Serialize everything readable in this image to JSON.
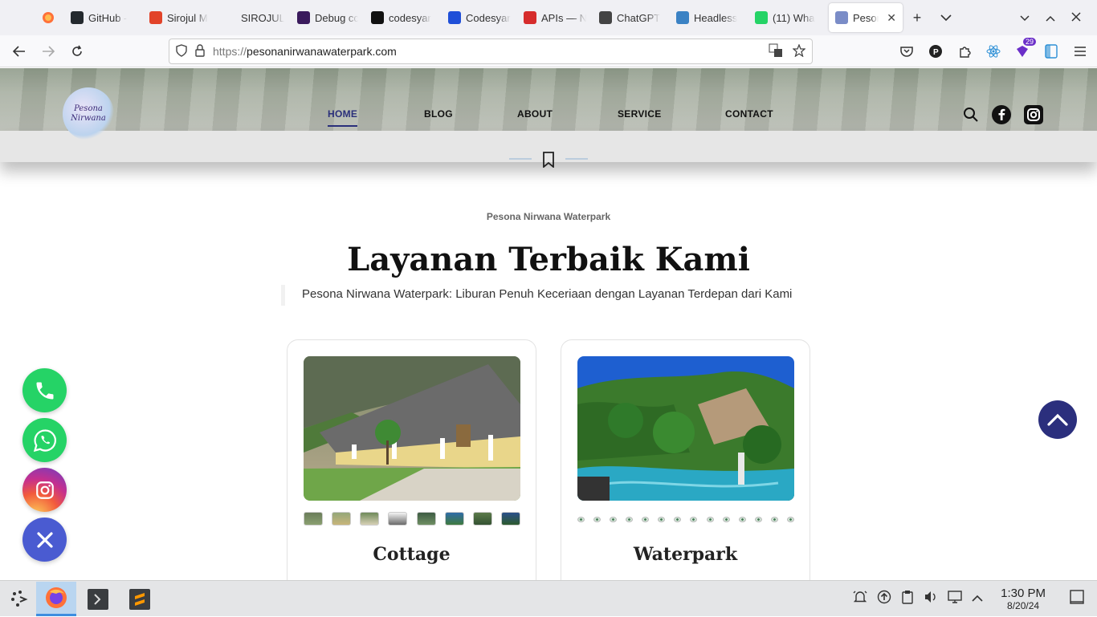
{
  "browser": {
    "tabs": [
      {
        "title": "GitHub -",
        "favicon": "github-icon",
        "color": "#24292e"
      },
      {
        "title": "Sirojul M",
        "favicon": "gitlab-icon",
        "color": "#e24329"
      },
      {
        "title": "SIROJUL MU",
        "favicon": "blank-icon",
        "color": "#f0f0f4"
      },
      {
        "title": "Debug cc",
        "favicon": "debug-icon",
        "color": "#3a1a5c"
      },
      {
        "title": "codesyar",
        "favicon": "codesyar-icon",
        "color": "#111111"
      },
      {
        "title": "Codesyar",
        "favicon": "codesyar-arrow-icon",
        "color": "#1f4fd8"
      },
      {
        "title": "APIs — N",
        "favicon": "apis-icon",
        "color": "#d62c2c"
      },
      {
        "title": "ChatGPT",
        "favicon": "chatgpt-icon",
        "color": "#444444"
      },
      {
        "title": "Headless",
        "favicon": "headless-icon",
        "color": "#3b82c4"
      },
      {
        "title": "(11) Wha",
        "favicon": "whatsapp-icon",
        "color": "#25d366"
      },
      {
        "title": "Peson",
        "favicon": "pesona-icon",
        "color": "#7a8cc7",
        "active": true
      }
    ],
    "url_protocol": "https://",
    "url_host": "pesonanirwanawaterpark.com",
    "extension_badge": "29"
  },
  "site": {
    "logo_text": "Pesona Nirwana",
    "menu": [
      "HOME",
      "BLOG",
      "ABOUT",
      "SERVICE",
      "CONTACT"
    ],
    "eyebrow": "Pesona Nirwana Waterpark",
    "title": "Layanan Terbaik Kami",
    "subtitle": "Pesona Nirwana Waterpark: Liburan Penuh Keceriaan dengan Layanan Terdepan dari Kami",
    "cards": [
      {
        "title": "Cottage",
        "thumb_count": 8
      },
      {
        "title": "Waterpark",
        "dot_count": 14
      }
    ],
    "accent": "#2b2f7d"
  },
  "taskbar": {
    "time": "1:30 PM",
    "date": "8/20/24"
  }
}
